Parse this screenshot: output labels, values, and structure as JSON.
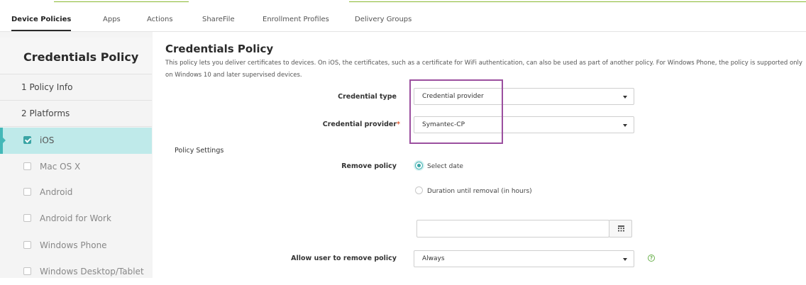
{
  "tabs": [
    {
      "label": "Device Policies",
      "active": true
    },
    {
      "label": "Apps",
      "active": false
    },
    {
      "label": "Actions",
      "active": false
    },
    {
      "label": "ShareFile",
      "active": false
    },
    {
      "label": "Enrollment Profiles",
      "active": false
    },
    {
      "label": "Delivery Groups",
      "active": false
    }
  ],
  "sidebar": {
    "title": "Credentials Policy",
    "steps": [
      "1  Policy Info",
      "2  Platforms"
    ],
    "platforms": [
      {
        "label": "iOS",
        "checked": true,
        "active": true
      },
      {
        "label": "Mac OS X",
        "checked": false,
        "active": false
      },
      {
        "label": "Android",
        "checked": false,
        "active": false
      },
      {
        "label": "Android for Work",
        "checked": false,
        "active": false
      },
      {
        "label": "Windows Phone",
        "checked": false,
        "active": false
      },
      {
        "label": "Windows Desktop/Tablet",
        "checked": false,
        "active": false
      }
    ]
  },
  "main": {
    "title": "Credentials Policy",
    "description": "This policy lets you deliver certificates to devices. On iOS, the certificates, such as a certificate for WiFi authentication, can also be used as part of another policy. For Windows Phone, the policy is supported only on Windows 10 and later supervised devices.",
    "credential_type": {
      "label": "Credential type",
      "value": "Credential provider"
    },
    "credential_provider": {
      "label": "Credential provider",
      "required_mark": "*",
      "value": "Symantec-CP"
    },
    "policy_settings_heading": "Policy Settings",
    "remove_policy": {
      "label": "Remove policy",
      "options": [
        {
          "label": "Select date",
          "selected": true
        },
        {
          "label": "Duration until removal (in hours)",
          "selected": false
        }
      ],
      "date_value": ""
    },
    "allow_user_remove": {
      "label": "Allow user to remove policy",
      "value": "Always"
    },
    "help_glyph": "?"
  },
  "colors": {
    "accent": "#43b8b8",
    "active_bg": "#bfeaea",
    "top_line": "#8ab830",
    "required": "#e2603a",
    "highlight_box": "#9b4f9f"
  },
  "icons": [
    "checkbox-icon",
    "chevron-down-icon",
    "calendar-icon",
    "help-icon"
  ]
}
